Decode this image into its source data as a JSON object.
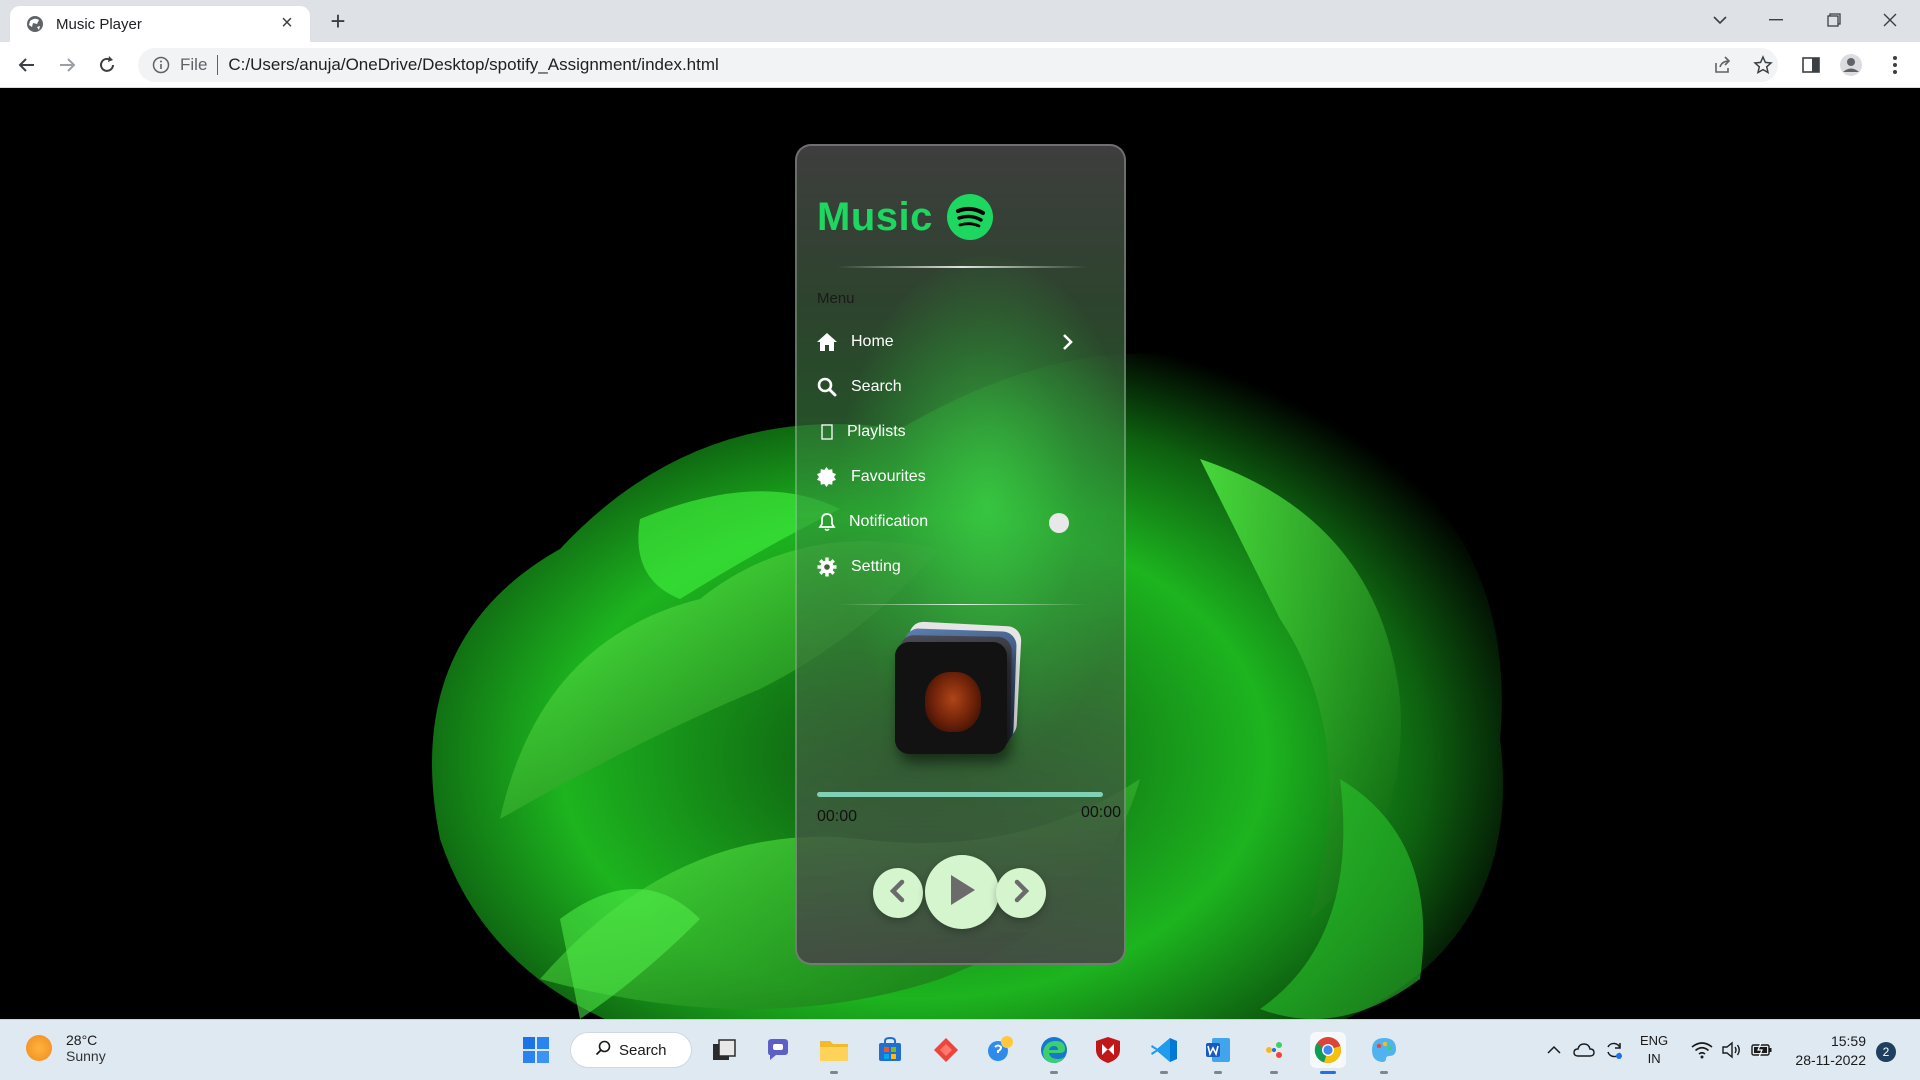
{
  "browser": {
    "tab_title": "Music Player",
    "tab_close": "×",
    "new_tab": "+",
    "address": {
      "scheme_label": "File",
      "url": "C:/Users/anuja/OneDrive/Desktop/spotify_Assignment/index.html"
    }
  },
  "player": {
    "brand": "Music",
    "menu_label": "Menu",
    "menu_items": [
      {
        "label": "Home",
        "icon": "home-icon"
      },
      {
        "label": "Search",
        "icon": "search-icon"
      },
      {
        "label": "Playlists",
        "icon": "playlist-icon"
      },
      {
        "label": "Favourites",
        "icon": "badge-icon"
      },
      {
        "label": "Notification",
        "icon": "bell-icon"
      },
      {
        "label": "Setting",
        "icon": "gear-icon"
      }
    ],
    "time_current": "00:00",
    "time_total": "00:00",
    "progress": 0,
    "accent": "#1ed760"
  },
  "taskbar": {
    "weather": {
      "temp": "28°C",
      "condition": "Sunny"
    },
    "search_label": "Search",
    "lang_top": "ENG",
    "lang_bottom": "IN",
    "time": "15:59",
    "date": "28-11-2022",
    "notifications": "2"
  }
}
